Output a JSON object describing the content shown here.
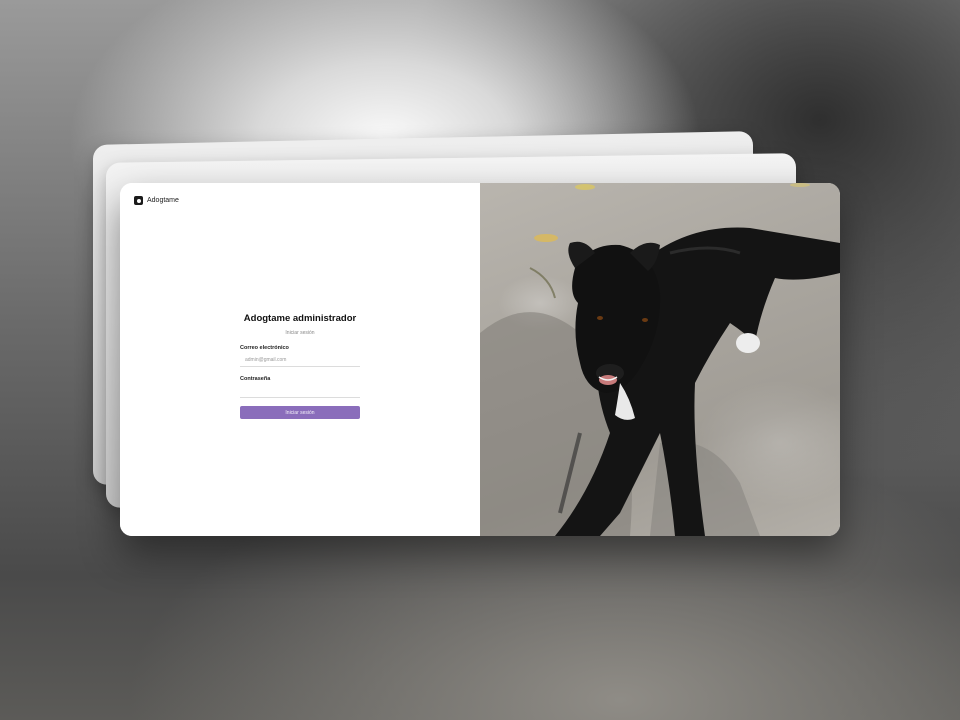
{
  "app": {
    "brand_name": "Adogtame"
  },
  "login": {
    "title": "Adogtame administrador",
    "subtitle": "Iniciar sesión",
    "email_label": "Correo electrónico",
    "email_placeholder": "admin@gmail.com",
    "password_label": "Contraseña",
    "password_placeholder": "",
    "submit_label": "Iniciar sesión"
  },
  "colors": {
    "accent": "#8a6dbb",
    "window_bg": "#ffffff",
    "text_primary": "#111111"
  },
  "image": {
    "subject": "black-dog-photo"
  }
}
